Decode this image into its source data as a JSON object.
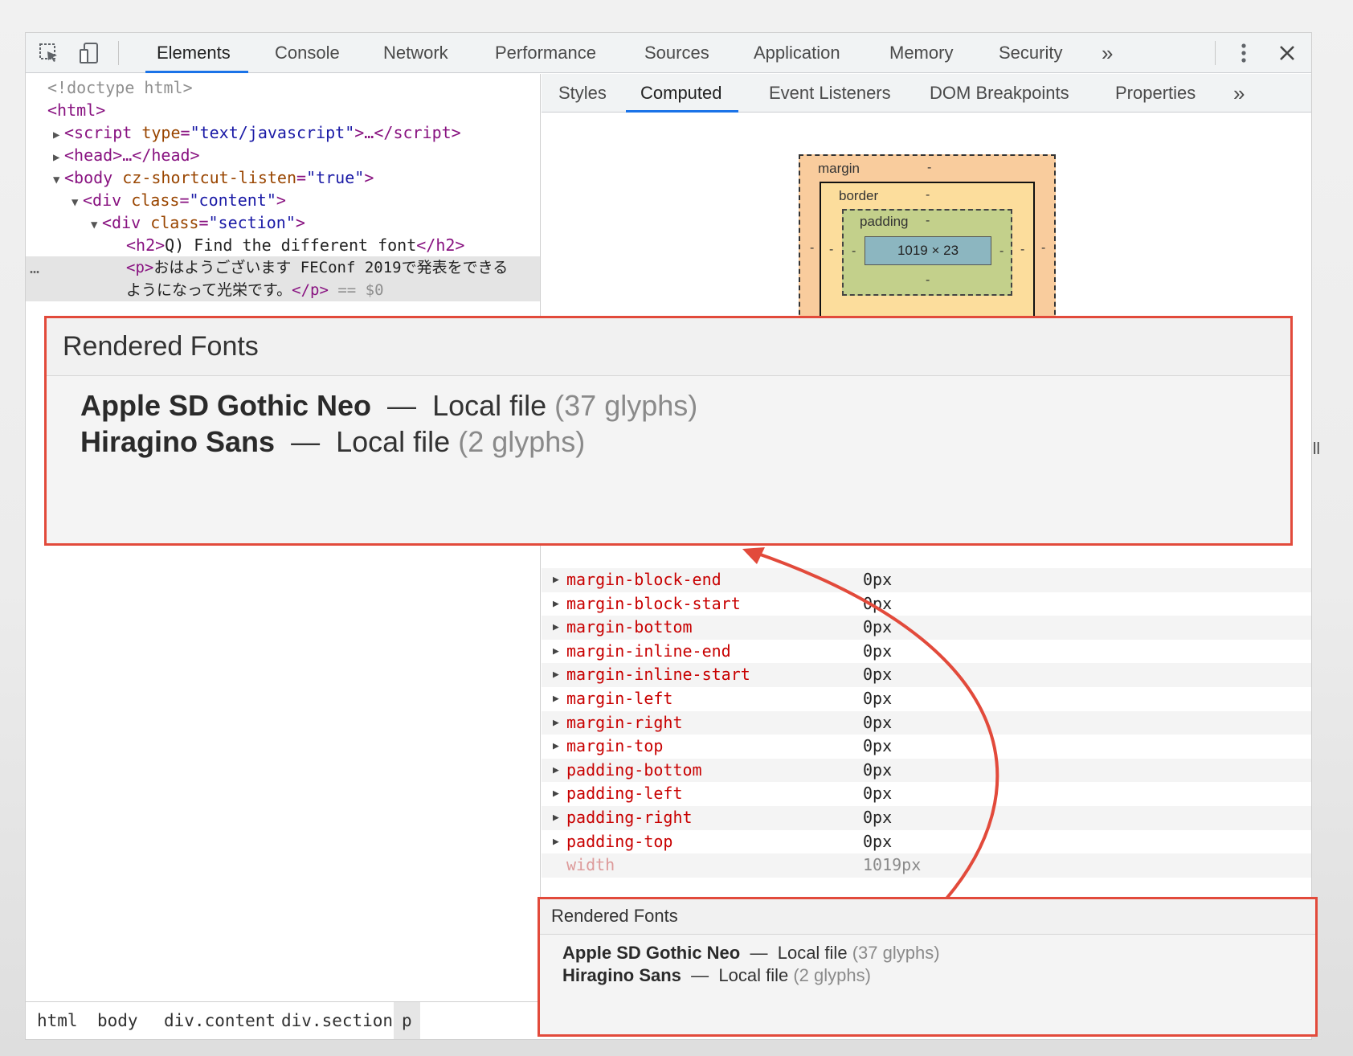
{
  "toolbar": {
    "tabs": [
      "Elements",
      "Console",
      "Network",
      "Performance",
      "Sources",
      "Application",
      "Memory",
      "Security"
    ],
    "more": "»",
    "menu_icon": "kebab-menu-icon",
    "close_icon": "close-icon",
    "inspect_icon": "inspect-element-icon",
    "device_icon": "device-toolbar-icon"
  },
  "dom": {
    "doctype": "<!doctype html>",
    "html_open": "<html>",
    "script_tag": "script",
    "script_attr": "type",
    "script_val": "\"text/javascript\"",
    "script_rest": ">…</",
    "script_close": "script>",
    "head_text": "<head>…</head>",
    "body_tag": "<body",
    "body_attr": "cz-shortcut-listen",
    "body_val": "\"true\"",
    "body_close": ">",
    "div1_tag": "<div",
    "div1_attr": "class",
    "div1_val": "\"content\"",
    "div2_tag": "<div",
    "div2_attr": "class",
    "div2_val": "\"section\"",
    "h2_open": "<h2>",
    "h2_text": "Q) Find the different font",
    "h2_close": "</h2>",
    "p_open": "<p>",
    "p_text_1": "おはようございます FEConf 2019で発表をできる",
    "p_text_2": "ようになって光栄です。",
    "p_close": "</p>",
    "p_marker": " == $0",
    "ellipsis": "…"
  },
  "breadcrumb": [
    "html",
    "body",
    "div.content",
    "div.section",
    "p"
  ],
  "side": {
    "tabs": [
      "Styles",
      "Computed",
      "Event Listeners",
      "DOM Breakpoints",
      "Properties"
    ],
    "more": "»",
    "active_tab": "Computed"
  },
  "box_model": {
    "margin_label": "margin",
    "border_label": "border",
    "padding_label": "padding",
    "content": "1019 × 23",
    "dash": "-"
  },
  "computed": {
    "partial_label": "ll",
    "properties": [
      {
        "name": "margin-block-end",
        "value": "0px"
      },
      {
        "name": "margin-block-start",
        "value": "0px"
      },
      {
        "name": "margin-bottom",
        "value": "0px"
      },
      {
        "name": "margin-inline-end",
        "value": "0px"
      },
      {
        "name": "margin-inline-start",
        "value": "0px"
      },
      {
        "name": "margin-left",
        "value": "0px"
      },
      {
        "name": "margin-right",
        "value": "0px"
      },
      {
        "name": "margin-top",
        "value": "0px"
      },
      {
        "name": "padding-bottom",
        "value": "0px"
      },
      {
        "name": "padding-left",
        "value": "0px"
      },
      {
        "name": "padding-right",
        "value": "0px"
      },
      {
        "name": "padding-top",
        "value": "0px"
      },
      {
        "name": "width",
        "value": "1019px"
      }
    ]
  },
  "rendered_fonts": {
    "title": "Rendered Fonts",
    "fonts": [
      {
        "name": "Apple SD Gothic Neo",
        "dash": "—",
        "source": "Local file",
        "count": "(37 glyphs)"
      },
      {
        "name": "Hiragino Sans",
        "dash": "—",
        "source": "Local file",
        "count": "(2 glyphs)"
      }
    ]
  },
  "colors": {
    "accent": "#1a73e8",
    "highlight": "#e24a3b",
    "tag": "#881280",
    "attr": "#994500",
    "value": "#1a1aa6",
    "prop": "#c80000"
  }
}
